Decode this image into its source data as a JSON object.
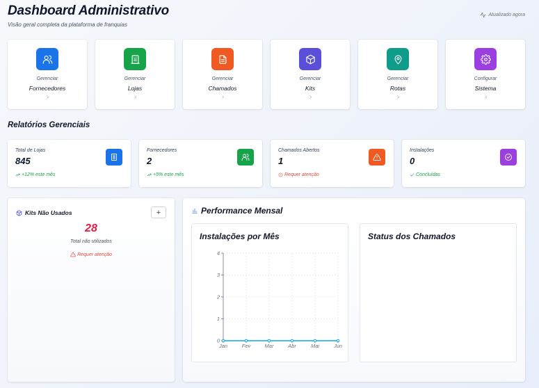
{
  "header": {
    "title": "Dashboard Administrativo",
    "subtitle": "Visão geral completa da plataforma de franquias",
    "updated": "Atualizado agora"
  },
  "quick_actions": [
    {
      "verb": "Gerenciar",
      "target": "Fornecedores",
      "icon": "users-icon",
      "color": "#1a73e8"
    },
    {
      "verb": "Gerenciar",
      "target": "Lojas",
      "icon": "building-icon",
      "color": "#16a34a"
    },
    {
      "verb": "Gerenciar",
      "target": "Chamados",
      "icon": "document-icon",
      "color": "#f05a22"
    },
    {
      "verb": "Gerenciar",
      "target": "Kits",
      "icon": "package-icon",
      "color": "#5b4fd9"
    },
    {
      "verb": "Gerenciar",
      "target": "Rotas",
      "icon": "map-pin-icon",
      "color": "#0f9d8a"
    },
    {
      "verb": "Configurar",
      "target": "Sistema",
      "icon": "gear-icon",
      "color": "#9b3fe0"
    }
  ],
  "reports": {
    "title": "Relatórios Gerenciais",
    "cards": [
      {
        "label": "Total de Lojas",
        "value": "845",
        "foot": "+12% este mês",
        "foot_icon": "trend-up-icon",
        "status": "good",
        "icon": "building-icon",
        "color": "#1a73e8"
      },
      {
        "label": "Fornecedores",
        "value": "2",
        "foot": "+5% este mês",
        "foot_icon": "trend-up-icon",
        "status": "good",
        "icon": "users-icon",
        "color": "#16a34a"
      },
      {
        "label": "Chamados Abertos",
        "value": "1",
        "foot": "Requer atenção",
        "foot_icon": "alert-circle-icon",
        "status": "warn",
        "icon": "alert-triangle-icon",
        "color": "#f05a22"
      },
      {
        "label": "Instalações",
        "value": "0",
        "foot": "Concluídas",
        "foot_icon": "check-icon",
        "status": "good",
        "icon": "check-circle-icon",
        "color": "#9b3fe0"
      }
    ]
  },
  "kits": {
    "title": "Kits Não Usados",
    "add_label": "+",
    "value": "28",
    "caption": "Total não utilizados",
    "warning": "Requer atenção"
  },
  "performance": {
    "title": "Performance Mensal",
    "left_panel_title": "Instalações por Mês",
    "right_panel_title": "Status dos Chamados"
  },
  "chart_data": {
    "type": "line",
    "title": "Instalações por Mês",
    "categories": [
      "Jan",
      "Fev",
      "Mar",
      "Abr",
      "Mai",
      "Jun"
    ],
    "series": [
      {
        "values": [
          0,
          0,
          0,
          0,
          0,
          0
        ],
        "color": "#0ea5e9"
      }
    ],
    "ylim": [
      0,
      4
    ],
    "yticks": [
      0,
      1,
      2,
      3,
      4
    ],
    "grid": true,
    "legend": "none"
  }
}
